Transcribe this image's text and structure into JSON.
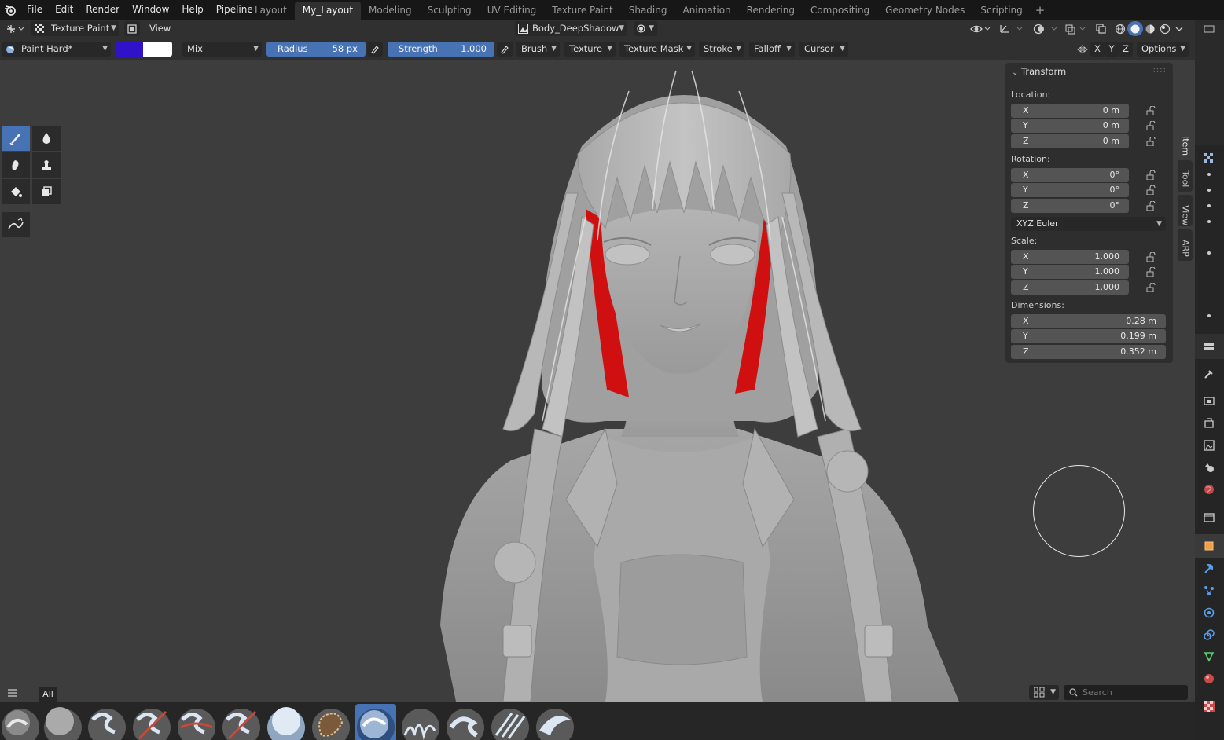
{
  "app": {
    "menu": [
      "File",
      "Edit",
      "Render",
      "Window",
      "Help",
      "Pipeline"
    ],
    "workspaces": [
      "Layout",
      "My_Layout",
      "Modeling",
      "Sculpting",
      "UV Editing",
      "Texture Paint",
      "Shading",
      "Animation",
      "Rendering",
      "Compositing",
      "Geometry Nodes",
      "Scripting"
    ],
    "active_workspace": "My_Layout",
    "add_workspace": "+"
  },
  "header": {
    "mode": "Texture Paint",
    "view_menu": "View",
    "image_name": "Body_DeepShadow"
  },
  "tool_header": {
    "brush_name": "Paint Hard*",
    "primary_color": "#3012c9",
    "secondary_color": "#ffffff",
    "blend_mode": "Mix",
    "radius_label": "Radius",
    "radius_value": "58 px",
    "strength_label": "Strength",
    "strength_value": "1.000",
    "strength_fraction": 1.0,
    "menus": [
      "Brush",
      "Texture",
      "Texture Mask",
      "Stroke",
      "Falloff",
      "Cursor"
    ],
    "mirror_axes": [
      "X",
      "Y",
      "Z"
    ],
    "options_label": "Options"
  },
  "transform": {
    "title": "Transform",
    "location_label": "Location:",
    "location": [
      {
        "axis": "X",
        "value": "0 m"
      },
      {
        "axis": "Y",
        "value": "0 m"
      },
      {
        "axis": "Z",
        "value": "0 m"
      }
    ],
    "rotation_label": "Rotation:",
    "rotation": [
      {
        "axis": "X",
        "value": "0°"
      },
      {
        "axis": "Y",
        "value": "0°"
      },
      {
        "axis": "Z",
        "value": "0°"
      }
    ],
    "rotation_mode": "XYZ Euler",
    "scale_label": "Scale:",
    "scale": [
      {
        "axis": "X",
        "value": "1.000"
      },
      {
        "axis": "Y",
        "value": "1.000"
      },
      {
        "axis": "Z",
        "value": "1.000"
      }
    ],
    "dimensions_label": "Dimensions:",
    "dimensions": [
      {
        "axis": "X",
        "value": "0.28 m"
      },
      {
        "axis": "Y",
        "value": "0.199 m"
      },
      {
        "axis": "Z",
        "value": "0.352 m"
      }
    ]
  },
  "sidebar_tabs": [
    "Item",
    "Tool",
    "View",
    "ARP"
  ],
  "active_sidebar_tab": "Item",
  "asset_shelf": {
    "catalog": "All",
    "search_placeholder": "Search"
  },
  "colors": {
    "accent": "#4772b3",
    "viewport_bg": "#3d3d3d",
    "paint_red": "#d01010"
  }
}
